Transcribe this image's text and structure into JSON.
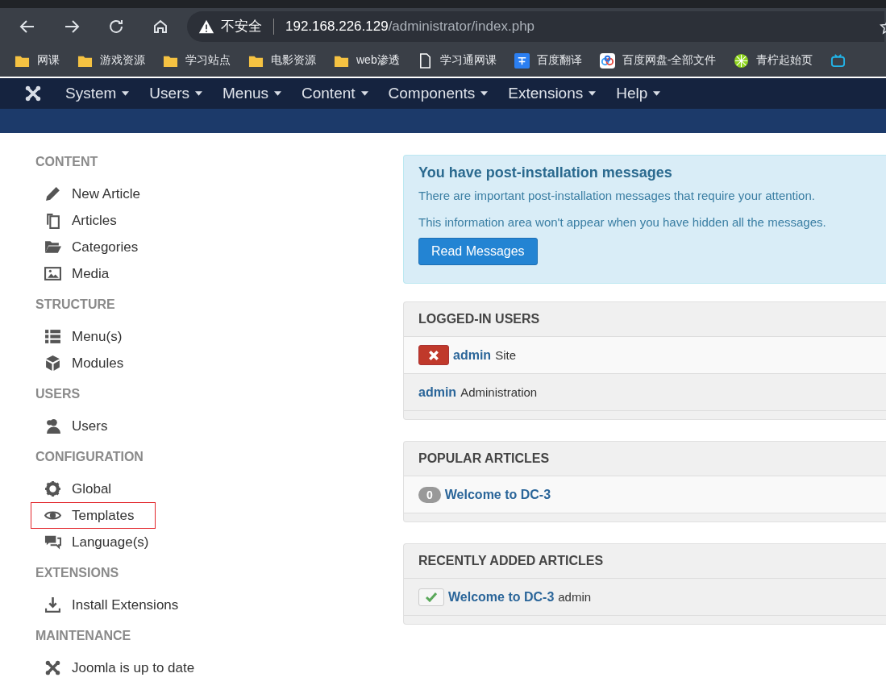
{
  "browser": {
    "security_label": "不安全",
    "url_host": "192.168.226.129",
    "url_path": "/administrator/index.php",
    "bookmarks": [
      {
        "kind": "folder",
        "label": "网课"
      },
      {
        "kind": "folder",
        "label": "游戏资源"
      },
      {
        "kind": "folder",
        "label": "学习站点"
      },
      {
        "kind": "folder",
        "label": "电影资源"
      },
      {
        "kind": "folder",
        "label": "web渗透"
      },
      {
        "kind": "page",
        "label": "学习通网课"
      },
      {
        "kind": "translate",
        "label": "百度翻译"
      },
      {
        "kind": "cloud",
        "label": "百度网盘-全部文件"
      },
      {
        "kind": "lime",
        "label": "青柠起始页"
      },
      {
        "kind": "tv"
      }
    ]
  },
  "navbar": {
    "menus": [
      "System",
      "Users",
      "Menus",
      "Content",
      "Components",
      "Extensions",
      "Help"
    ]
  },
  "sidebar": [
    {
      "heading": "CONTENT",
      "items": [
        {
          "kind": "pencil",
          "label": "New Article",
          "highlighted": false
        },
        {
          "kind": "copy",
          "label": "Articles",
          "highlighted": false
        },
        {
          "kind": "folder",
          "label": "Categories",
          "highlighted": false
        },
        {
          "kind": "image",
          "label": "Media",
          "highlighted": false
        }
      ]
    },
    {
      "heading": "STRUCTURE",
      "items": [
        {
          "kind": "list",
          "label": "Menu(s)",
          "highlighted": false
        },
        {
          "kind": "cube",
          "label": "Modules",
          "highlighted": false
        }
      ]
    },
    {
      "heading": "USERS",
      "items": [
        {
          "kind": "users",
          "label": "Users",
          "highlighted": false
        }
      ]
    },
    {
      "heading": "CONFIGURATION",
      "items": [
        {
          "kind": "gear",
          "label": "Global",
          "highlighted": false
        },
        {
          "kind": "eye",
          "label": "Templates",
          "highlighted": true
        },
        {
          "kind": "chat",
          "label": "Language(s)",
          "highlighted": false
        }
      ]
    },
    {
      "heading": "EXTENSIONS",
      "items": [
        {
          "kind": "download",
          "label": "Install Extensions",
          "highlighted": false
        }
      ]
    },
    {
      "heading": "MAINTENANCE",
      "items": [
        {
          "kind": "joomla",
          "label": "Joomla is up to date",
          "highlighted": false
        }
      ]
    }
  ],
  "alert": {
    "title": "You have post-installation messages",
    "lines": [
      "There are important post-installation messages that require your attention.",
      "This information area won't appear when you have hidden all the messages."
    ],
    "button": "Read Messages"
  },
  "logged_in_users": {
    "title": "LOGGED-IN USERS",
    "rows": [
      {
        "logout_button": true,
        "name": "admin",
        "client": "Site"
      },
      {
        "logout_button": false,
        "name": "admin",
        "client": "Administration"
      }
    ]
  },
  "popular_articles": {
    "title": "POPULAR ARTICLES",
    "rows": [
      {
        "hits": "0",
        "title": "Welcome to DC-3"
      }
    ]
  },
  "recent_articles": {
    "title": "RECENTLY ADDED ARTICLES",
    "rows": [
      {
        "published": true,
        "title": "Welcome to DC-3",
        "author": "admin"
      }
    ]
  }
}
